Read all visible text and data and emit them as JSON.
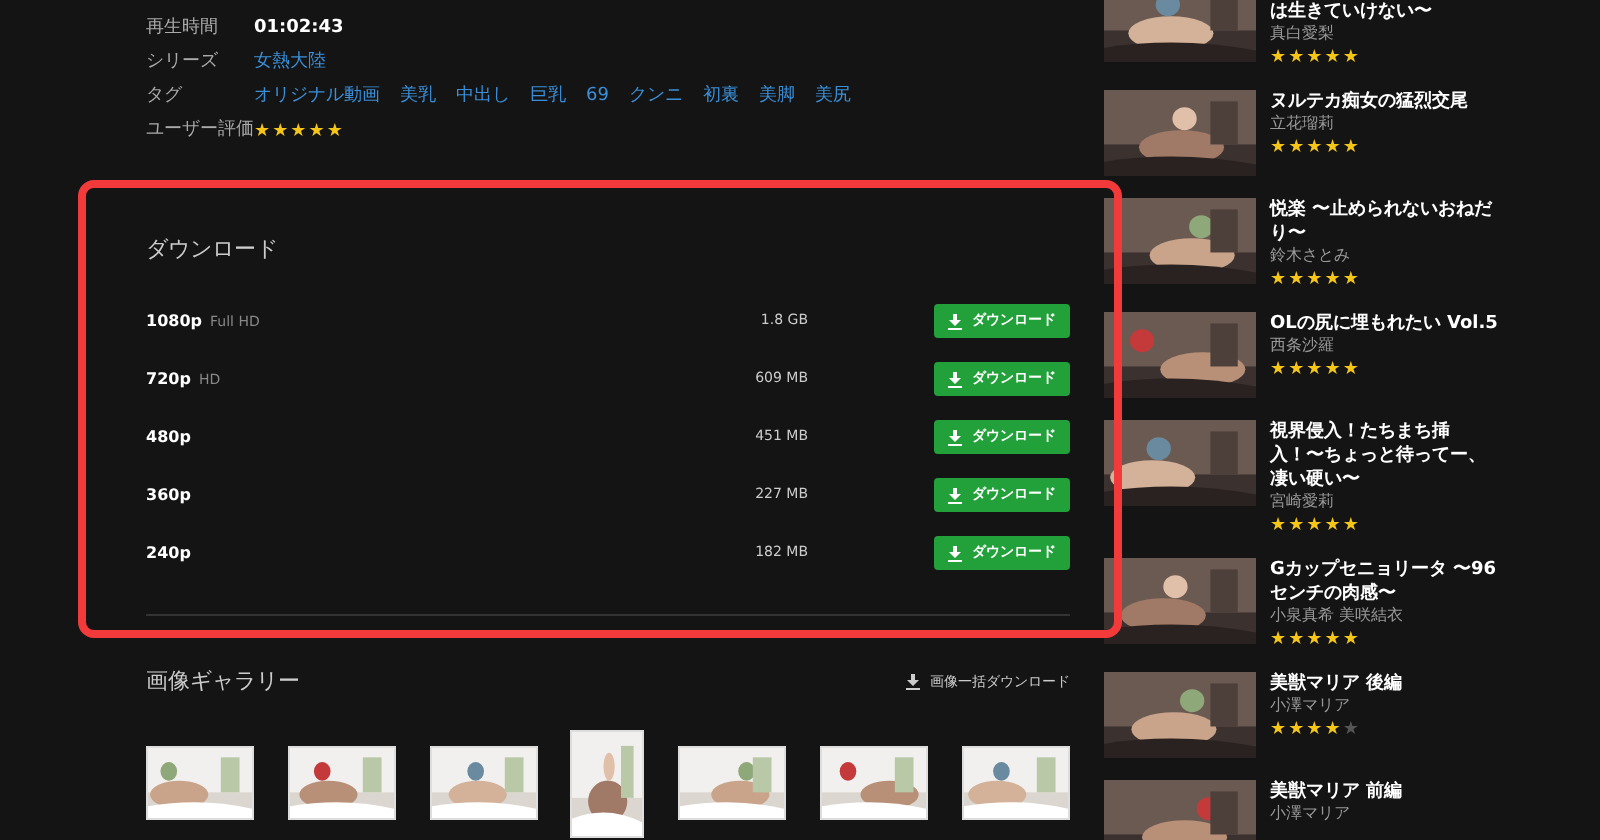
{
  "details": [
    {
      "label": "再生時間",
      "kind": "text",
      "value": "01:02:43"
    },
    {
      "label": "シリーズ",
      "kind": "links",
      "values": [
        "女熱大陸"
      ]
    },
    {
      "label": "タグ",
      "kind": "links",
      "values": [
        "オリジナル動画",
        "美乳",
        "中出し",
        "巨乳",
        "69",
        "クンニ",
        "初裏",
        "美脚",
        "美尻"
      ]
    },
    {
      "label": "ユーザー評価",
      "kind": "stars",
      "stars": 5
    }
  ],
  "download": {
    "title": "ダウンロード",
    "highlighted": true,
    "rows": [
      {
        "resolution": "1080p",
        "quality": "Full HD",
        "size": "1.8 GB",
        "button": "ダウンロード"
      },
      {
        "resolution": "720p",
        "quality": "HD",
        "size": "609 MB",
        "button": "ダウンロード"
      },
      {
        "resolution": "480p",
        "size": "451 MB",
        "button": "ダウンロード"
      },
      {
        "resolution": "360p",
        "size": "227 MB",
        "button": "ダウンロード"
      },
      {
        "resolution": "240p",
        "size": "182 MB",
        "button": "ダウンロード"
      }
    ]
  },
  "gallery": {
    "title": "画像ギャラリー",
    "bulk_download": "画像一括ダウンロード",
    "images": [
      {
        "kind": "picture",
        "portrait": false
      },
      {
        "kind": "picture",
        "portrait": false
      },
      {
        "kind": "picture",
        "portrait": false
      },
      {
        "kind": "picture",
        "portrait": true
      },
      {
        "kind": "picture",
        "portrait": false
      },
      {
        "kind": "picture",
        "portrait": false
      },
      {
        "kind": "picture",
        "portrait": false
      }
    ]
  },
  "sidebar": {
    "items": [
      {
        "title": "は生きていけない〜",
        "author": "真白愛梨",
        "stars": 5
      },
      {
        "title": "ヌルテカ痴女の猛烈交尾",
        "author": "立花瑠莉",
        "stars": 5
      },
      {
        "title": "悦楽 〜止められないおねだり〜",
        "author": "鈴木さとみ",
        "stars": 5
      },
      {
        "title": "OLの尻に埋もれたい Vol.5",
        "author": "西条沙羅",
        "stars": 5
      },
      {
        "title": "視界侵入！たちまち挿入！〜ちょっと待ってー、凄い硬い〜",
        "author": "宮崎愛莉",
        "stars": 5
      },
      {
        "title": "Gカップセニョリータ 〜96センチの肉感〜",
        "author": "小泉真希 美咲結衣",
        "stars": 5
      },
      {
        "title": "美獣マリア 後編",
        "author": "小澤マリア",
        "stars": 4
      },
      {
        "title": "美獣マリア 前編",
        "author": "小澤マリア"
      }
    ]
  }
}
